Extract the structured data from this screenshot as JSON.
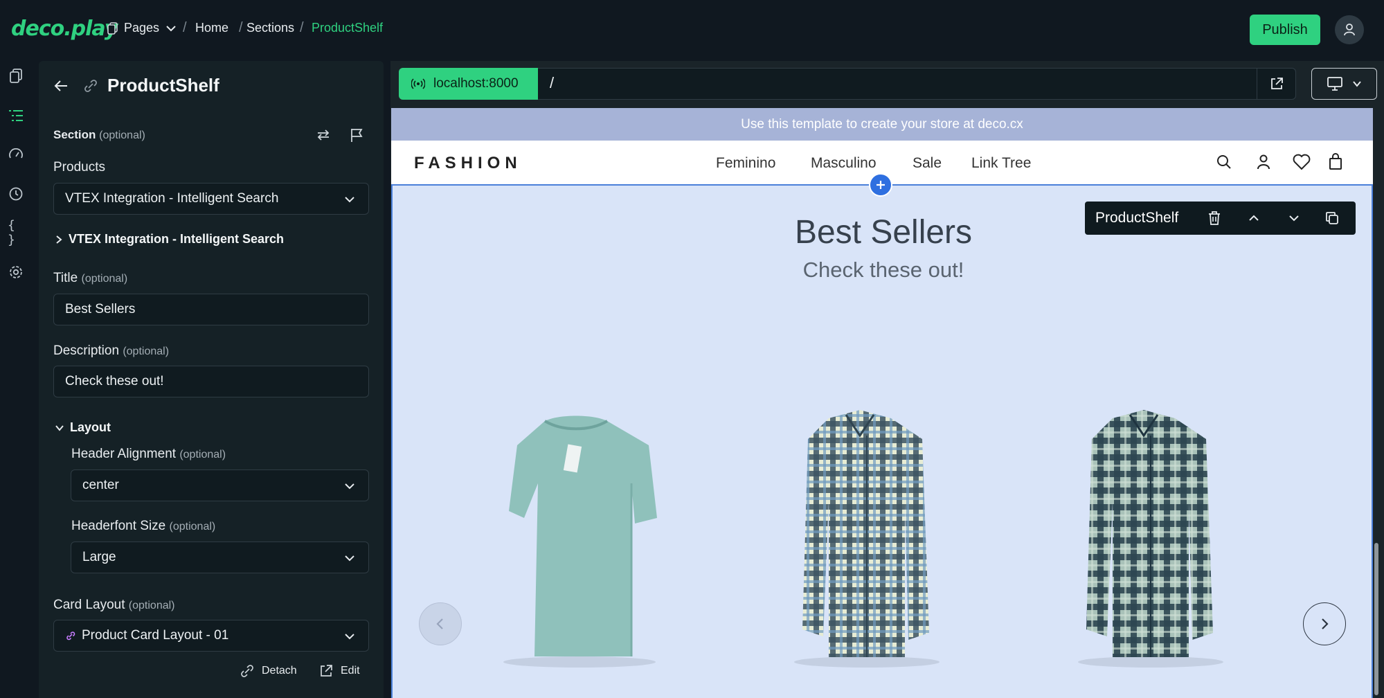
{
  "app": {
    "logo": "deco.play",
    "breadcrumb": {
      "pages_label": "Pages",
      "items": [
        "Home",
        "Sections",
        "ProductShelf"
      ]
    },
    "publish_label": "Publish",
    "accent_color": "#2fd180"
  },
  "rail": {
    "icons": [
      "pages-icon",
      "sections-icon",
      "analytics-icon",
      "history-icon",
      "code-icon",
      "settings-icon"
    ]
  },
  "panel": {
    "title": "ProductShelf",
    "section_label": "Section",
    "optional": "(optional)",
    "products_label": "Products",
    "products_value": "VTEX Integration - Intelligent Search",
    "products_expand_label": "VTEX Integration - Intelligent Search",
    "title_label": "Title",
    "title_value": "Best Sellers",
    "description_label": "Description",
    "description_value": "Check these out!",
    "layout_label": "Layout",
    "header_alignment_label": "Header Alignment",
    "header_alignment_value": "center",
    "headerfont_size_label": "Headerfont Size",
    "headerfont_size_value": "Large",
    "card_layout_label": "Card Layout",
    "card_layout_value": "Product Card Layout - 01",
    "detach_label": "Detach",
    "edit_label": "Edit"
  },
  "preview": {
    "host": "localhost:8000",
    "path": "/",
    "promo_text": "Use this template to create your store at deco.cx",
    "brand": "FASHION",
    "nav_links": [
      "Feminino",
      "Masculino",
      "Sale",
      "Link Tree"
    ],
    "section_toolbar_title": "ProductShelf",
    "shelf_title": "Best Sellers",
    "shelf_description": "Check these out!"
  }
}
